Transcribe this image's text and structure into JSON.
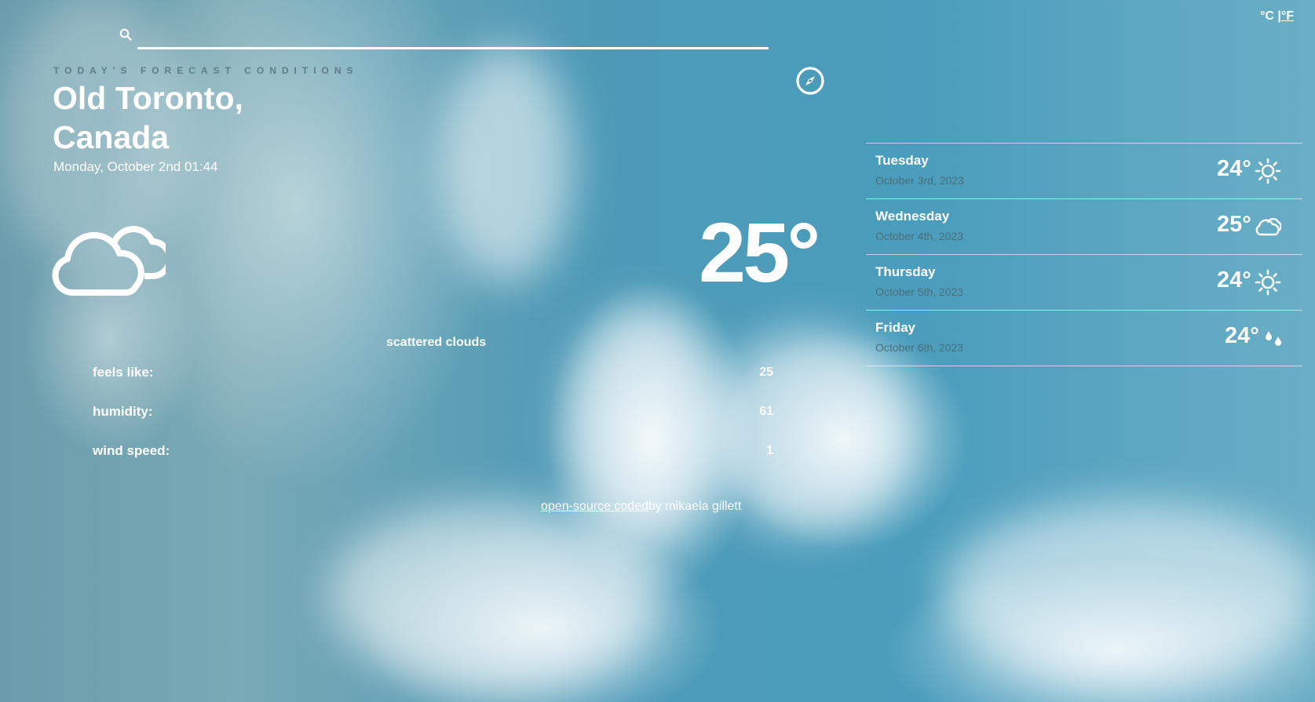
{
  "header": {
    "search": {
      "value": "",
      "placeholder": ""
    },
    "units": {
      "celsius": "°C",
      "separator": "|",
      "fahrenheit": "°F"
    }
  },
  "current": {
    "overline": "TODAY'S FORECAST CONDITIONS",
    "city": "Old Toronto, Canada",
    "datetime": "Monday, October 2nd 01:44",
    "temperature": "25°",
    "icon": "cloud-icon",
    "description": "scattered clouds",
    "details": [
      {
        "label": "feels like:",
        "value": "25"
      },
      {
        "label": "humidity:",
        "value": "61"
      },
      {
        "label": "wind speed:",
        "value": "1"
      }
    ]
  },
  "forecast": [
    {
      "day": "Tuesday",
      "date": "October 3rd, 2023",
      "temp": "24°",
      "icon": "sun-icon"
    },
    {
      "day": "Wednesday",
      "date": "October 4th, 2023",
      "temp": "25°",
      "icon": "cloud-icon"
    },
    {
      "day": "Thursday",
      "date": "October 5th, 2023",
      "temp": "24°",
      "icon": "sun-icon"
    },
    {
      "day": "Friday",
      "date": "October 6th, 2023",
      "temp": "24°",
      "icon": "raindrops-icon"
    }
  ],
  "credit": {
    "link_text": "open-source coded",
    "suffix": "by mikaela gillett"
  },
  "colors": {
    "sky": "#4a9dbc",
    "text": "#ffffff",
    "muted": "#5f7d86"
  }
}
